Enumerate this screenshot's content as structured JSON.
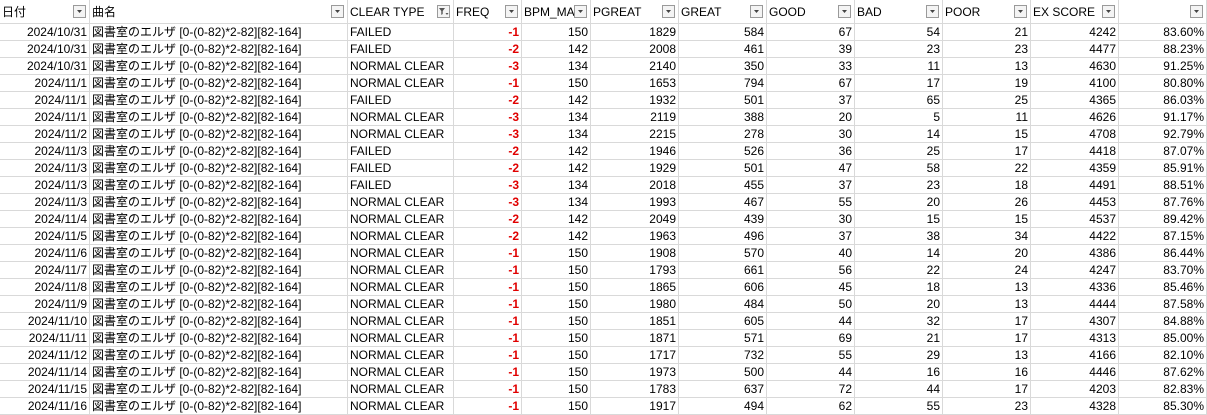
{
  "headers": [
    "日付",
    "曲名",
    "CLEAR TYPE",
    "FREQ",
    "BPM_MA",
    "PGREAT",
    "GREAT",
    "GOOD",
    "BAD",
    "POOR",
    "EX SCORE",
    ""
  ],
  "filter_icons": [
    "dropdown-icon",
    "dropdown-icon",
    "filter-active-icon",
    "dropdown-icon",
    "dropdown-icon",
    "dropdown-icon",
    "dropdown-icon",
    "dropdown-icon",
    "dropdown-icon",
    "dropdown-icon",
    "dropdown-icon",
    "dropdown-icon"
  ],
  "neg_color": "#e00000",
  "rows": [
    [
      "2024/10/31",
      "図書室のエルザ [0-(0-82)*2-82][82-164]",
      "FAILED",
      "-1",
      "150",
      "1829",
      "584",
      "67",
      "54",
      "21",
      "4242",
      "83.60%"
    ],
    [
      "2024/10/31",
      "図書室のエルザ [0-(0-82)*2-82][82-164]",
      "FAILED",
      "-2",
      "142",
      "2008",
      "461",
      "39",
      "23",
      "23",
      "4477",
      "88.23%"
    ],
    [
      "2024/10/31",
      "図書室のエルザ [0-(0-82)*2-82][82-164]",
      "NORMAL CLEAR",
      "-3",
      "134",
      "2140",
      "350",
      "33",
      "11",
      "13",
      "4630",
      "91.25%"
    ],
    [
      "2024/11/1",
      "図書室のエルザ [0-(0-82)*2-82][82-164]",
      "NORMAL CLEAR",
      "-1",
      "150",
      "1653",
      "794",
      "67",
      "17",
      "19",
      "4100",
      "80.80%"
    ],
    [
      "2024/11/1",
      "図書室のエルザ [0-(0-82)*2-82][82-164]",
      "FAILED",
      "-2",
      "142",
      "1932",
      "501",
      "37",
      "65",
      "25",
      "4365",
      "86.03%"
    ],
    [
      "2024/11/1",
      "図書室のエルザ [0-(0-82)*2-82][82-164]",
      "NORMAL CLEAR",
      "-3",
      "134",
      "2119",
      "388",
      "20",
      "5",
      "11",
      "4626",
      "91.17%"
    ],
    [
      "2024/11/2",
      "図書室のエルザ [0-(0-82)*2-82][82-164]",
      "NORMAL CLEAR",
      "-3",
      "134",
      "2215",
      "278",
      "30",
      "14",
      "15",
      "4708",
      "92.79%"
    ],
    [
      "2024/11/3",
      "図書室のエルザ [0-(0-82)*2-82][82-164]",
      "FAILED",
      "-2",
      "142",
      "1946",
      "526",
      "36",
      "25",
      "17",
      "4418",
      "87.07%"
    ],
    [
      "2024/11/3",
      "図書室のエルザ [0-(0-82)*2-82][82-164]",
      "FAILED",
      "-2",
      "142",
      "1929",
      "501",
      "47",
      "58",
      "22",
      "4359",
      "85.91%"
    ],
    [
      "2024/11/3",
      "図書室のエルザ [0-(0-82)*2-82][82-164]",
      "FAILED",
      "-3",
      "134",
      "2018",
      "455",
      "37",
      "23",
      "18",
      "4491",
      "88.51%"
    ],
    [
      "2024/11/3",
      "図書室のエルザ [0-(0-82)*2-82][82-164]",
      "NORMAL CLEAR",
      "-3",
      "134",
      "1993",
      "467",
      "55",
      "20",
      "26",
      "4453",
      "87.76%"
    ],
    [
      "2024/11/4",
      "図書室のエルザ [0-(0-82)*2-82][82-164]",
      "NORMAL CLEAR",
      "-2",
      "142",
      "2049",
      "439",
      "30",
      "15",
      "15",
      "4537",
      "89.42%"
    ],
    [
      "2024/11/5",
      "図書室のエルザ [0-(0-82)*2-82][82-164]",
      "NORMAL CLEAR",
      "-2",
      "142",
      "1963",
      "496",
      "37",
      "38",
      "34",
      "4422",
      "87.15%"
    ],
    [
      "2024/11/6",
      "図書室のエルザ [0-(0-82)*2-82][82-164]",
      "NORMAL CLEAR",
      "-1",
      "150",
      "1908",
      "570",
      "40",
      "14",
      "20",
      "4386",
      "86.44%"
    ],
    [
      "2024/11/7",
      "図書室のエルザ [0-(0-82)*2-82][82-164]",
      "NORMAL CLEAR",
      "-1",
      "150",
      "1793",
      "661",
      "56",
      "22",
      "24",
      "4247",
      "83.70%"
    ],
    [
      "2024/11/8",
      "図書室のエルザ [0-(0-82)*2-82][82-164]",
      "NORMAL CLEAR",
      "-1",
      "150",
      "1865",
      "606",
      "45",
      "18",
      "13",
      "4336",
      "85.46%"
    ],
    [
      "2024/11/9",
      "図書室のエルザ [0-(0-82)*2-82][82-164]",
      "NORMAL CLEAR",
      "-1",
      "150",
      "1980",
      "484",
      "50",
      "20",
      "13",
      "4444",
      "87.58%"
    ],
    [
      "2024/11/10",
      "図書室のエルザ [0-(0-82)*2-82][82-164]",
      "NORMAL CLEAR",
      "-1",
      "150",
      "1851",
      "605",
      "44",
      "32",
      "17",
      "4307",
      "84.88%"
    ],
    [
      "2024/11/11",
      "図書室のエルザ [0-(0-82)*2-82][82-164]",
      "NORMAL CLEAR",
      "-1",
      "150",
      "1871",
      "571",
      "69",
      "21",
      "17",
      "4313",
      "85.00%"
    ],
    [
      "2024/11/12",
      "図書室のエルザ [0-(0-82)*2-82][82-164]",
      "NORMAL CLEAR",
      "-1",
      "150",
      "1717",
      "732",
      "55",
      "29",
      "13",
      "4166",
      "82.10%"
    ],
    [
      "2024/11/14",
      "図書室のエルザ [0-(0-82)*2-82][82-164]",
      "NORMAL CLEAR",
      "-1",
      "150",
      "1973",
      "500",
      "44",
      "16",
      "16",
      "4446",
      "87.62%"
    ],
    [
      "2024/11/15",
      "図書室のエルザ [0-(0-82)*2-82][82-164]",
      "NORMAL CLEAR",
      "-1",
      "150",
      "1783",
      "637",
      "72",
      "44",
      "17",
      "4203",
      "82.83%"
    ],
    [
      "2024/11/16",
      "図書室のエルザ [0-(0-82)*2-82][82-164]",
      "NORMAL CLEAR",
      "-1",
      "150",
      "1917",
      "494",
      "62",
      "55",
      "23",
      "4328",
      "85.30%"
    ]
  ]
}
